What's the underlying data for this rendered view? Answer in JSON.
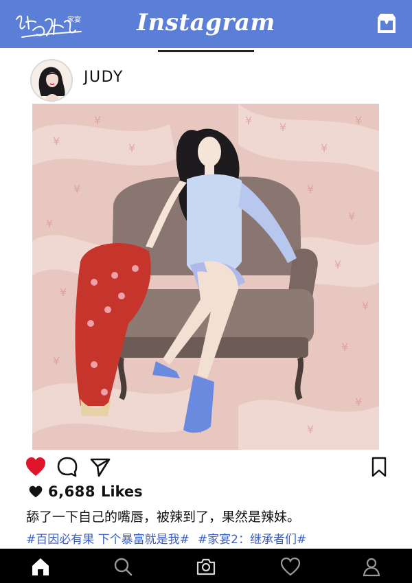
{
  "header": {
    "brand": "Instagram",
    "logo_text": "继承者们",
    "logo_badge": "家宴",
    "bg_color": "#5b7fd6"
  },
  "profile": {
    "username": "JUDY"
  },
  "post": {
    "image_description": "illustration-woman-armchair",
    "likes_count": "6,688",
    "likes_label": "Likes",
    "caption": "舔了一下自己的嘴唇，被辣到了，果然是辣妹。",
    "hashtags": [
      "#百因必有果 下个暴富就是我#",
      "#家宴2：继承者们#"
    ],
    "hashtag_color": "#3b5ec8"
  },
  "actions": {
    "like_icon": "heart-filled-icon",
    "comment_icon": "comment-icon",
    "share_icon": "paper-plane-icon",
    "save_icon": "bookmark-icon",
    "like_color": "#e0142a"
  },
  "bottom_nav": {
    "items": [
      "home-icon",
      "search-icon",
      "camera-icon",
      "heart-icon",
      "profile-icon"
    ]
  }
}
